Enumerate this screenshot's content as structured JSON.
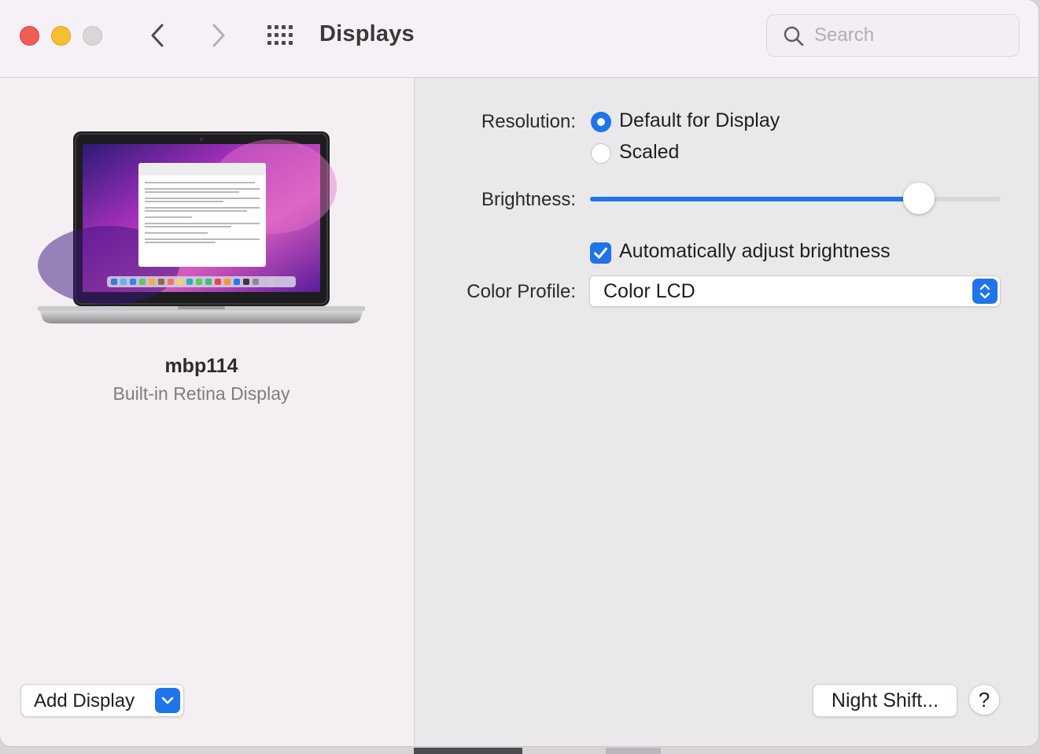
{
  "window": {
    "title": "Displays"
  },
  "toolbar": {
    "back_icon": "chevron-left-icon",
    "forward_icon": "chevron-right-icon",
    "grid_icon": "grid-icon",
    "search": {
      "placeholder": "Search",
      "value": "",
      "icon": "search-icon"
    }
  },
  "sidebar": {
    "display_name": "mbp114",
    "display_type": "Built-in Retina Display",
    "add_display_label": "Add Display"
  },
  "settings": {
    "resolution_label": "Resolution:",
    "resolution_options": [
      {
        "label": "Default for Display",
        "selected": true
      },
      {
        "label": "Scaled",
        "selected": false
      }
    ],
    "brightness_label": "Brightness:",
    "brightness_value": 0.8,
    "auto_brightness_label": "Automatically adjust brightness",
    "auto_brightness_checked": true,
    "color_profile_label": "Color Profile:",
    "color_profile_value": "Color LCD",
    "night_shift_label": "Night Shift...",
    "help_label": "?"
  },
  "colors": {
    "accent": "#1e74e8",
    "close": "#ee5e57",
    "minimize": "#f6be33",
    "zoom_disabled": "#d9d5d9"
  }
}
